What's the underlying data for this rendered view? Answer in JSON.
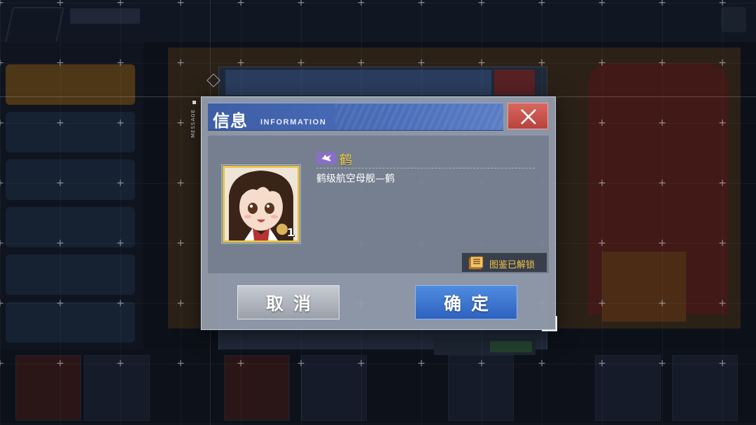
{
  "dialog": {
    "side_label": "MESSAGE",
    "title": "信息",
    "subtitle": "INFORMATION",
    "close_icon": "close-x-icon"
  },
  "ship": {
    "type_icon": "carrier-plane-icon",
    "name": "鹤",
    "description": "鹤级航空母舰—鹤",
    "count": "1",
    "name_color": "#f2d14a"
  },
  "unlock": {
    "icon": "book-icon",
    "label": "图鉴已解锁"
  },
  "buttons": {
    "cancel": "取消",
    "confirm": "确定"
  },
  "colors": {
    "header_blue": "#4a6cb8",
    "close_red": "#c9524b",
    "confirm_blue": "#3a72d0",
    "cancel_gray": "#a9aeb7",
    "unlock_gold": "#f0c24a"
  }
}
